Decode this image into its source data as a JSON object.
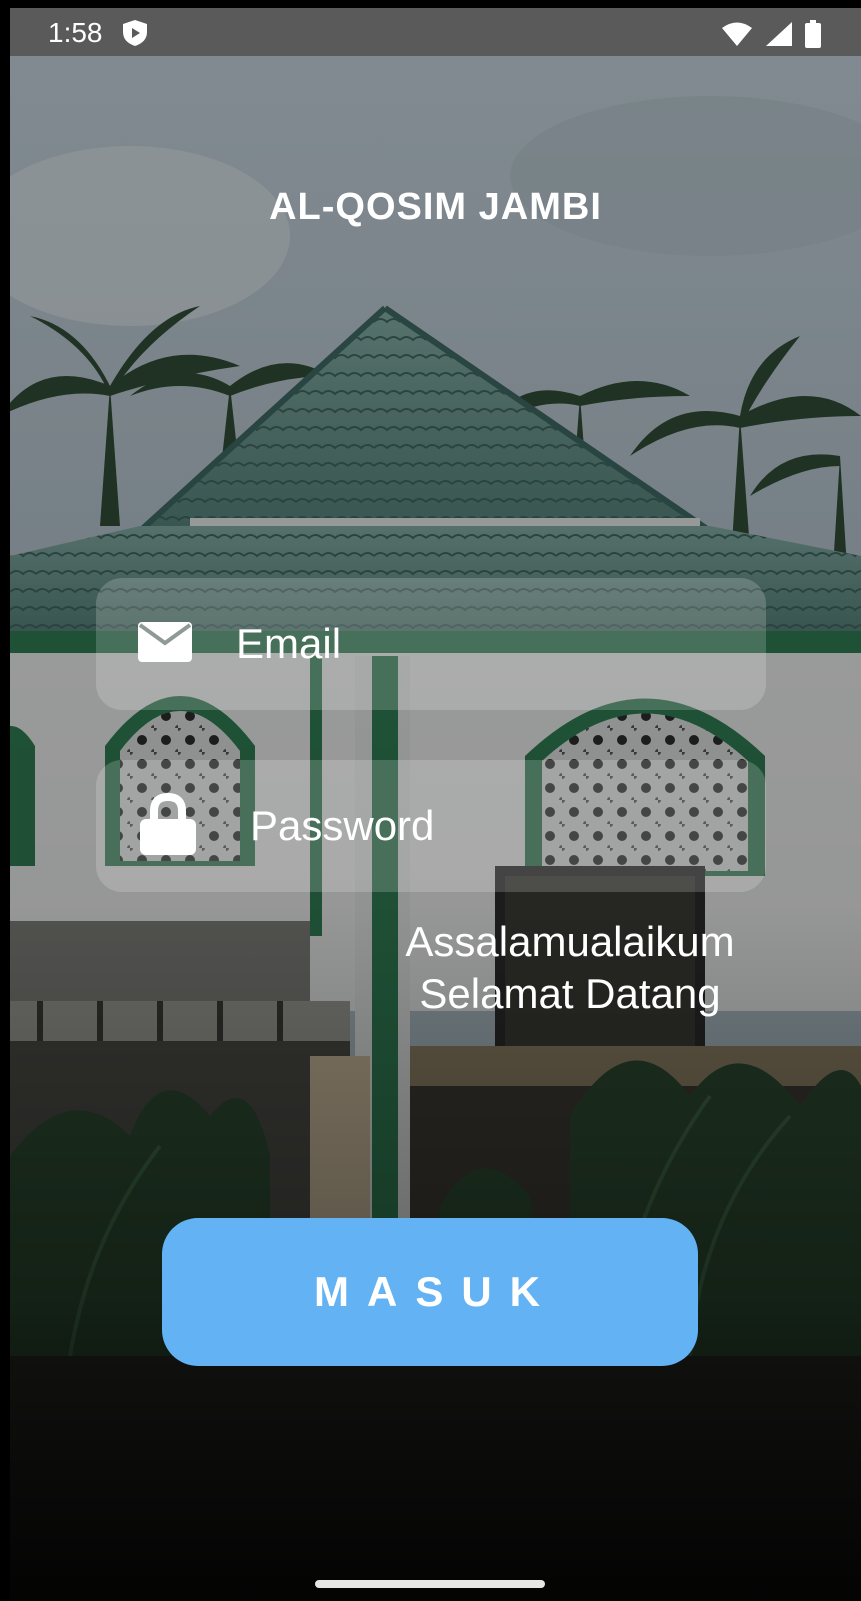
{
  "status_bar": {
    "time": "1:58",
    "icons": [
      "shield-icon",
      "wifi-icon",
      "cell-signal-icon",
      "battery-icon"
    ]
  },
  "app": {
    "title": "AL-QOSIM JAMBI"
  },
  "login_form": {
    "email_placeholder": "Email",
    "password_placeholder": "Password",
    "email_icon": "envelope-icon",
    "password_icon": "lock-icon"
  },
  "greeting": {
    "line1": "Assalamualaikum",
    "line2": "Selamat Datang"
  },
  "login_button": {
    "label": "MASUK"
  },
  "colors": {
    "button": "#63b3f4",
    "field_bg": "rgba(255,255,255,0.18)",
    "text": "#ffffff",
    "status_bar": "#5a5a5a"
  }
}
